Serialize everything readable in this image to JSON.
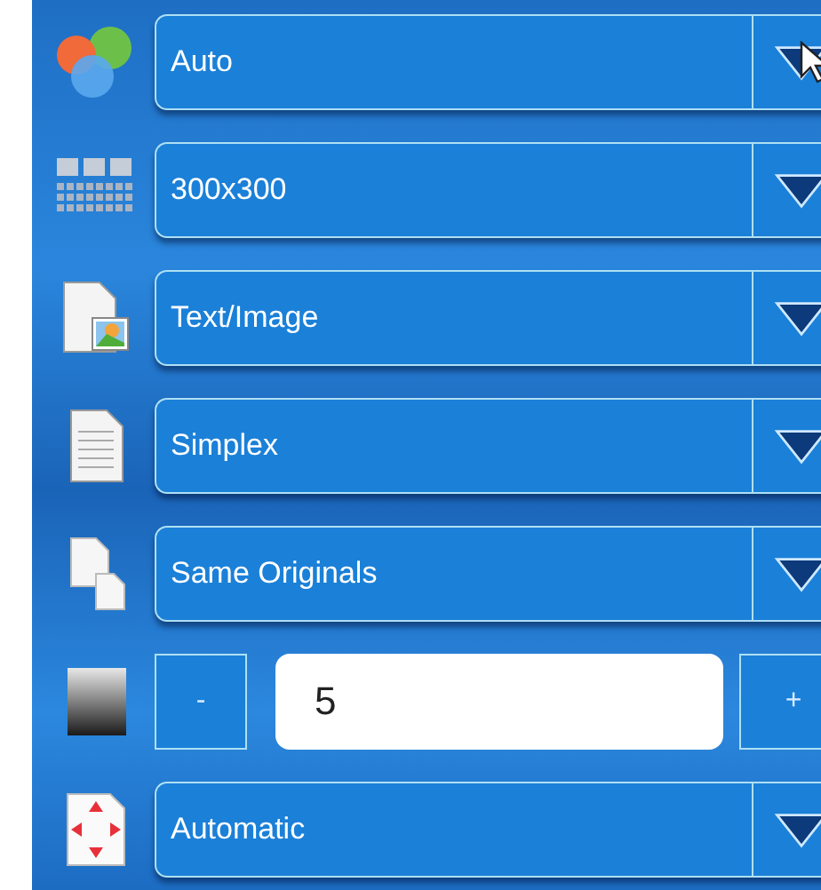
{
  "rows": [
    {
      "kind": "dropdown",
      "value": "Auto",
      "pointer": true
    },
    {
      "kind": "dropdown",
      "value": "300x300",
      "pointer": false
    },
    {
      "kind": "dropdown",
      "value": "Text/Image",
      "pointer": false
    },
    {
      "kind": "dropdown",
      "value": "Simplex",
      "pointer": false
    },
    {
      "kind": "dropdown",
      "value": "Same Originals",
      "pointer": false
    },
    {
      "kind": "stepper",
      "minus": "-",
      "value": "5",
      "plus": "+"
    },
    {
      "kind": "dropdown",
      "value": "Automatic",
      "pointer": false
    }
  ]
}
